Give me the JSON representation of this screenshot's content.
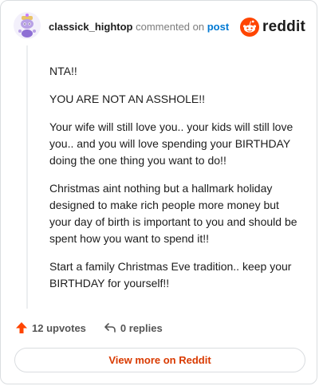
{
  "header": {
    "username": "classick_hightop",
    "action_text": "commented on",
    "post_link": "post",
    "brand": "reddit"
  },
  "comment": {
    "paragraphs": [
      "NTA!!",
      "YOU ARE NOT AN ASSHOLE!!",
      "Your wife will still love you.. your kids will still love you.. and you will love spending your BIRTHDAY doing the one thing you want to do!!",
      "Christmas aint nothing but a hallmark holiday designed to make rich people more money but your day of birth is important to you and should be spent how you want to spend it!!",
      "Start a family Christmas Eve tradition.. keep your BIRTHDAY for yourself!!"
    ]
  },
  "actions": {
    "upvotes": "12 upvotes",
    "replies": "0 replies"
  },
  "footer": {
    "view_more": "View more on Reddit"
  },
  "colors": {
    "accent": "#ff4500",
    "link": "#0079d3",
    "view_more": "#d93a00"
  },
  "icons": {
    "avatar": "snoo-avatar-icon",
    "brand": "reddit-logo-icon",
    "upvote": "upvote-arrow-icon",
    "reply": "reply-arrow-icon"
  }
}
